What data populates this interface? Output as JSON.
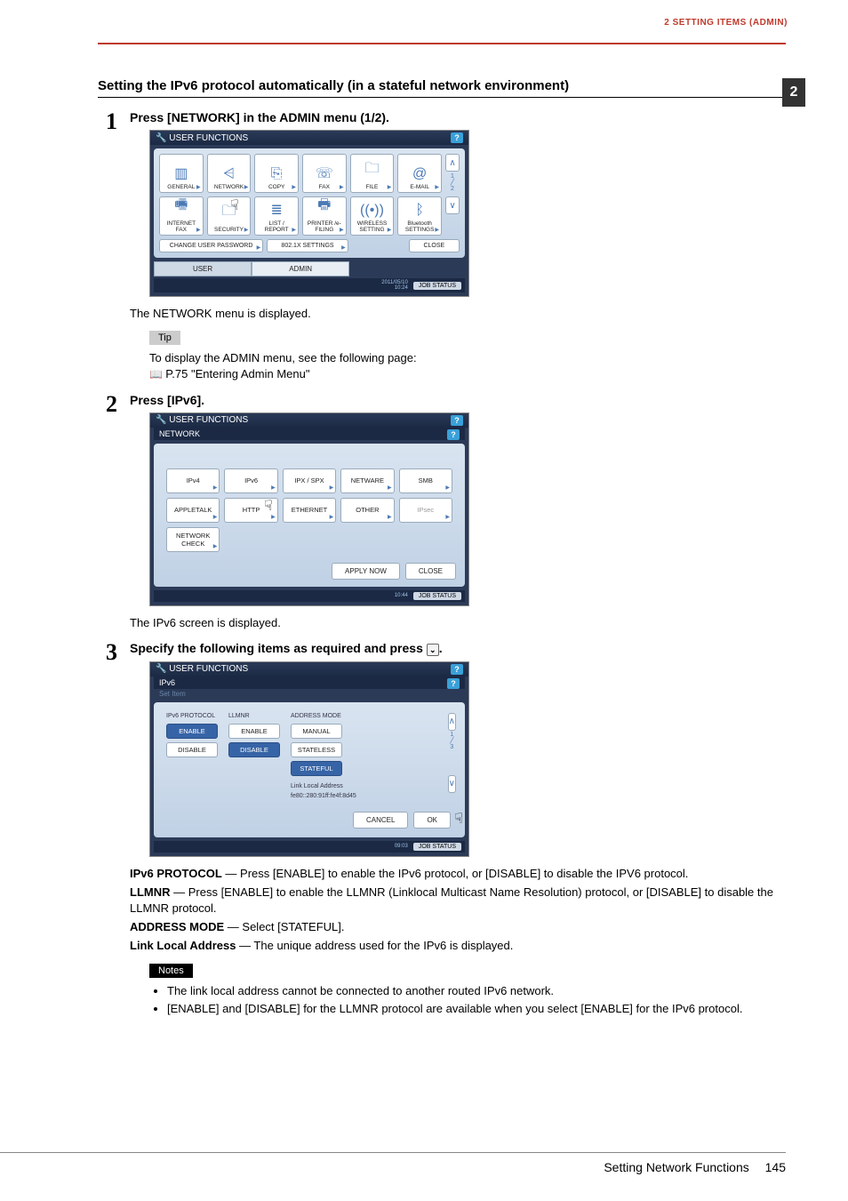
{
  "header": {
    "chapter_tag": "2 SETTING ITEMS (ADMIN)",
    "thumb_tab": "2"
  },
  "section_title": "Setting the IPv6 protocol automatically (in a stateful network environment)",
  "steps": {
    "s1": {
      "num": "1",
      "lead": "Press [NETWORK] in the ADMIN menu (1/2).",
      "after_text": "The NETWORK menu is displayed.",
      "tip_label": "Tip",
      "tip_line1": "To display the ADMIN menu, see the following page:",
      "tip_line2": "P.75 \"Entering Admin Menu\""
    },
    "s2": {
      "num": "2",
      "lead": "Press [IPv6].",
      "after_text": "The IPv6 screen is displayed."
    },
    "s3": {
      "num": "3",
      "lead_prefix": "Specify the following items as required and press ",
      "lead_suffix": ".",
      "desc": {
        "p1_b": "IPv6 PROTOCOL",
        "p1_t": " — Press [ENABLE] to enable the IPv6 protocol, or [DISABLE] to disable the IPV6 protocol.",
        "p2_b": "LLMNR",
        "p2_t": " — Press [ENABLE] to enable the LLMNR (Linklocal Multicast Name Resolution) protocol, or [DISABLE] to disable the LLMNR protocol.",
        "p3_b": "ADDRESS MODE",
        "p3_t": " — Select [STATEFUL].",
        "p4_b": "Link Local Address",
        "p4_t": " — The unique address used for the IPv6 is displayed."
      },
      "notes_label": "Notes",
      "notes": {
        "n1": "The link local address cannot be connected to another routed IPv6 network.",
        "n2": "[ENABLE] and [DISABLE] for the LLMNR protocol are available when you select [ENABLE] for the IPv6 protocol."
      }
    }
  },
  "ss1": {
    "title": "USER FUNCTIONS",
    "help": "?",
    "icons": {
      "general": "GENERAL",
      "network": "NETWORK",
      "copy": "COPY",
      "fax": "FAX",
      "file": "FILE",
      "email": "E-MAIL",
      "internetfax": "INTERNET FAX",
      "security": "SECURITY",
      "listreport": "LIST / REPORT",
      "printer": "PRINTER /e-FILING",
      "wireless": "WIRELESS SETTING",
      "bluetooth": "Bluetooth SETTINGS"
    },
    "page_top": "1",
    "page_bot": "2",
    "bar": {
      "change_pw": "CHANGE USER PASSWORD",
      "dot1x": "802.1X SETTINGS",
      "close": "CLOSE"
    },
    "tabs": {
      "user": "USER",
      "admin": "ADMIN"
    },
    "timestamp1": "2011/05/10",
    "timestamp2": "10:24",
    "jobstatus": "JOB STATUS"
  },
  "ss2": {
    "title": "USER FUNCTIONS",
    "sub": "NETWORK",
    "help": "?",
    "btns": {
      "ipv4": "IPv4",
      "ipv6": "IPv6",
      "ipx": "IPX / SPX",
      "netware": "NETWARE",
      "smb": "SMB",
      "appletalk": "APPLETALK",
      "http": "HTTP",
      "ethernet": "ETHERNET",
      "other": "OTHER",
      "ipsec": "IPsec",
      "netcheck": "NETWORK CHECK"
    },
    "apply": "APPLY NOW",
    "close": "CLOSE",
    "timestamp": "10:44",
    "jobstatus": "JOB STATUS"
  },
  "ss3": {
    "title": "USER FUNCTIONS",
    "sub": "IPv6",
    "subcap": "Set Item",
    "help": "?",
    "col1": {
      "label": "IPv6 PROTOCOL",
      "enable": "ENABLE",
      "disable": "DISABLE"
    },
    "col2": {
      "label": "LLMNR",
      "enable": "ENABLE",
      "disable": "DISABLE"
    },
    "col3": {
      "label": "ADDRESS MODE",
      "manual": "MANUAL",
      "stateless": "STATELESS",
      "stateful": "STATEFUL"
    },
    "lla_label": "Link Local Address",
    "lla_value": "fe80::280:91ff:fe4f:8d45",
    "page_top": "1",
    "page_bot": "3",
    "cancel": "CANCEL",
    "ok": "OK",
    "timestamp": "09:03",
    "jobstatus": "JOB STATUS"
  },
  "footer": {
    "section": "Setting Network Functions",
    "page": "145"
  }
}
